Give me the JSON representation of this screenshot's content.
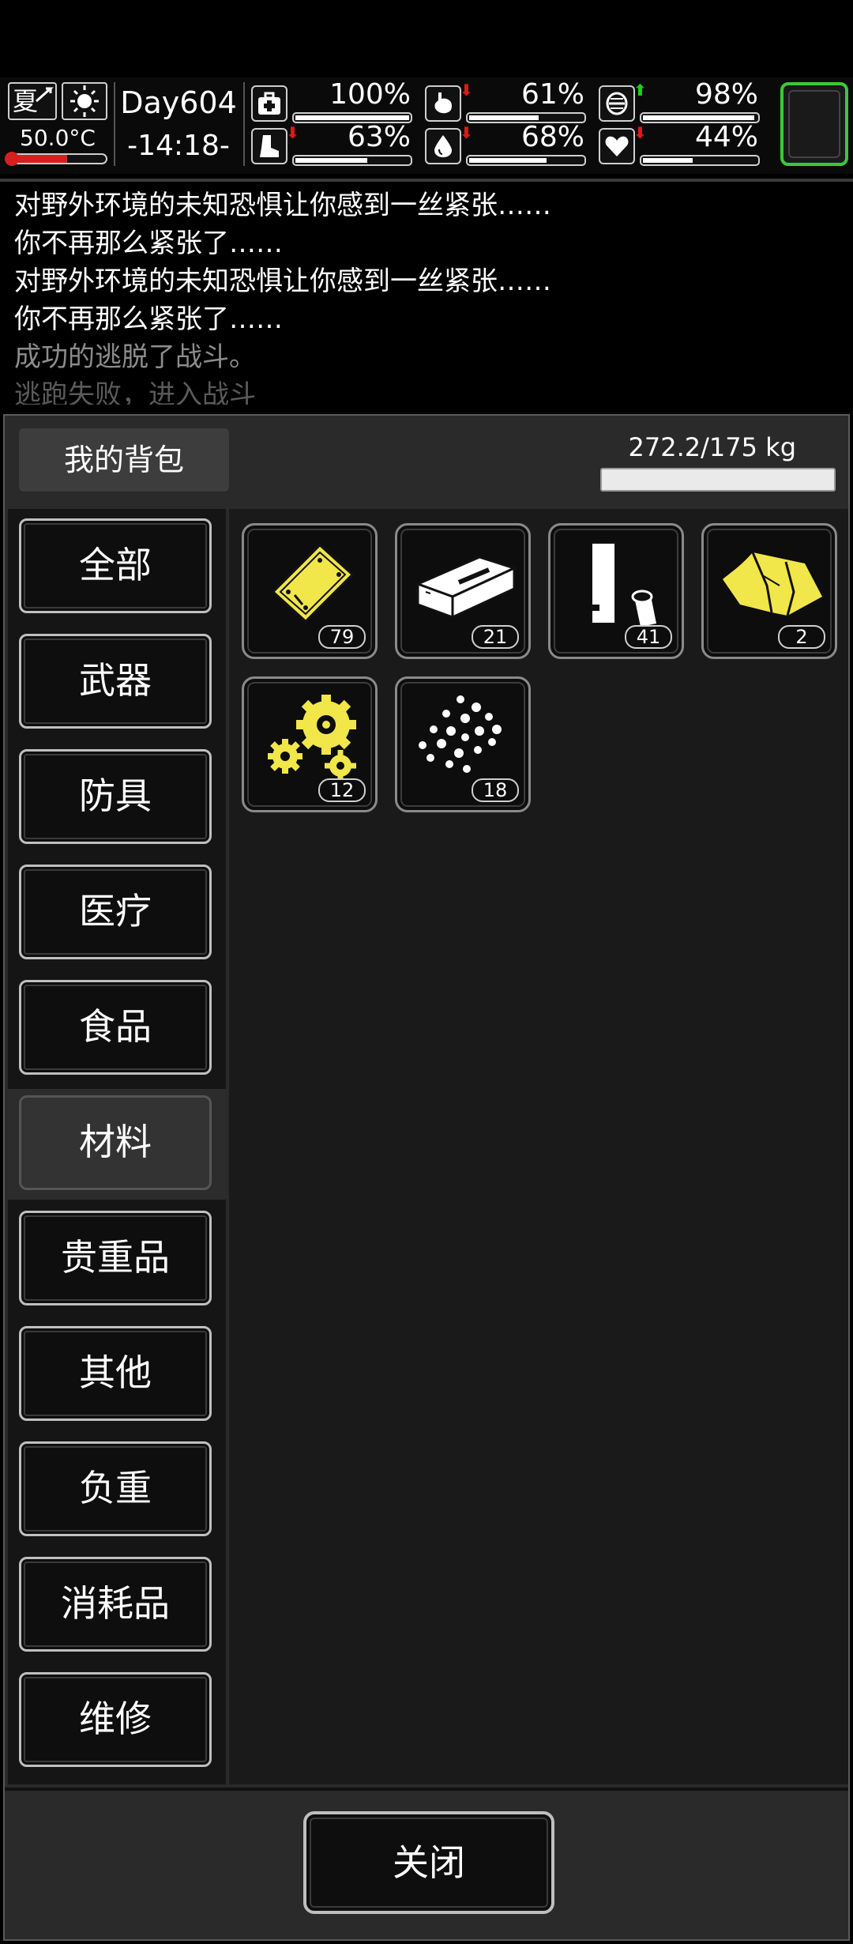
{
  "hud": {
    "season": "夏",
    "temperature": "50.0°C",
    "temperature_level": 0.6,
    "day": "Day604",
    "time": "-14:18-",
    "stats": [
      {
        "name": "health",
        "icon": "medkit-icon",
        "value": "100%",
        "level": 1.0,
        "trend": "none"
      },
      {
        "name": "hunger",
        "icon": "stomach-icon",
        "value": "61%",
        "level": 0.61,
        "trend": "down"
      },
      {
        "name": "sanity",
        "icon": "brain-icon",
        "value": "98%",
        "level": 0.98,
        "trend": "up"
      },
      {
        "name": "stamina",
        "icon": "boot-icon",
        "value": "63%",
        "level": 0.63,
        "trend": "down"
      },
      {
        "name": "thirst",
        "icon": "water-drop-icon",
        "value": "68%",
        "level": 0.68,
        "trend": "down"
      },
      {
        "name": "mood",
        "icon": "heart-icon",
        "value": "44%",
        "level": 0.44,
        "trend": "down"
      }
    ],
    "slot_color": "#3cc83c"
  },
  "log": {
    "lines": [
      "对野外环境的未知恐惧让你感到一丝紧张……",
      "你不再那么紧张了……",
      "对野外环境的未知恐惧让你感到一丝紧张……",
      "你不再那么紧张了……",
      "成功的逃脱了战斗。",
      "逃跑失败，进入战斗"
    ]
  },
  "backpack": {
    "title": "我的背包",
    "weight": "272.2/175 kg",
    "categories": [
      "全部",
      "武器",
      "防具",
      "医疗",
      "食品",
      "材料",
      "贵重品",
      "其他",
      "负重",
      "消耗品",
      "维修"
    ],
    "active_category": "材料",
    "items": [
      {
        "icon": "metal-plate-icon",
        "count": "79"
      },
      {
        "icon": "brick-icon",
        "count": "21"
      },
      {
        "icon": "pipe-icon",
        "count": "41"
      },
      {
        "icon": "cloth-icon",
        "count": "2"
      },
      {
        "icon": "gears-icon",
        "count": "12"
      },
      {
        "icon": "beads-icon",
        "count": "18"
      }
    ],
    "close_label": "关闭"
  },
  "colors": {
    "item_yellow": "#f1e64a",
    "alert_red": "#e01818",
    "up_green": "#18d018"
  }
}
